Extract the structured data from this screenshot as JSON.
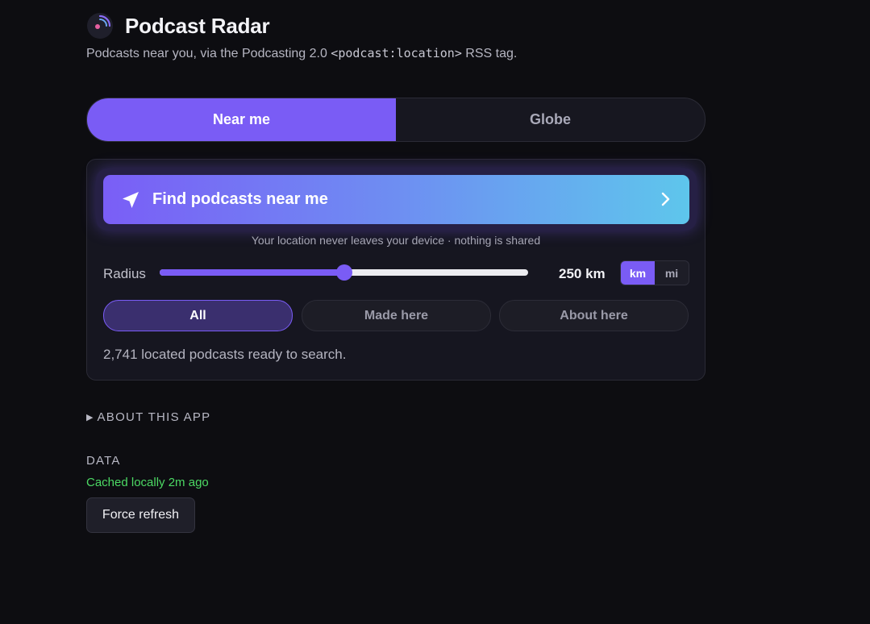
{
  "header": {
    "title": "Podcast Radar",
    "subtitle_before": "Podcasts near you, via the Podcasting 2.0 ",
    "subtitle_code": "<podcast:location>",
    "subtitle_after": " RSS tag.",
    "logo_icon": "radar-icon"
  },
  "mode_tabs": [
    {
      "label": "Near me",
      "active": true
    },
    {
      "label": "Globe",
      "active": false
    }
  ],
  "find": {
    "label": "Find podcasts near me",
    "icon": "location-arrow-icon",
    "chevron_icon": "chevron-right-icon",
    "privacy_note": "Your location never leaves your device · nothing is shared"
  },
  "radius": {
    "label": "Radius",
    "value_text": "250 km",
    "slider_fraction": 0.5,
    "units": [
      {
        "label": "km",
        "active": true
      },
      {
        "label": "mi",
        "active": false
      }
    ]
  },
  "filters": [
    {
      "label": "All",
      "active": true
    },
    {
      "label": "Made here",
      "active": false
    },
    {
      "label": "About here",
      "active": false
    }
  ],
  "status_text": "2,741 located podcasts ready to search.",
  "about": {
    "label": "ABOUT THIS APP"
  },
  "data_section": {
    "heading": "DATA",
    "cache_status": "Cached locally 2m ago",
    "refresh_label": "Force refresh"
  },
  "colors": {
    "accent": "#7a5cf5",
    "background": "#0d0d11",
    "cache_ok": "#4cd964",
    "gradient_start": "#7a5ef6",
    "gradient_end": "#5ec6ec"
  }
}
